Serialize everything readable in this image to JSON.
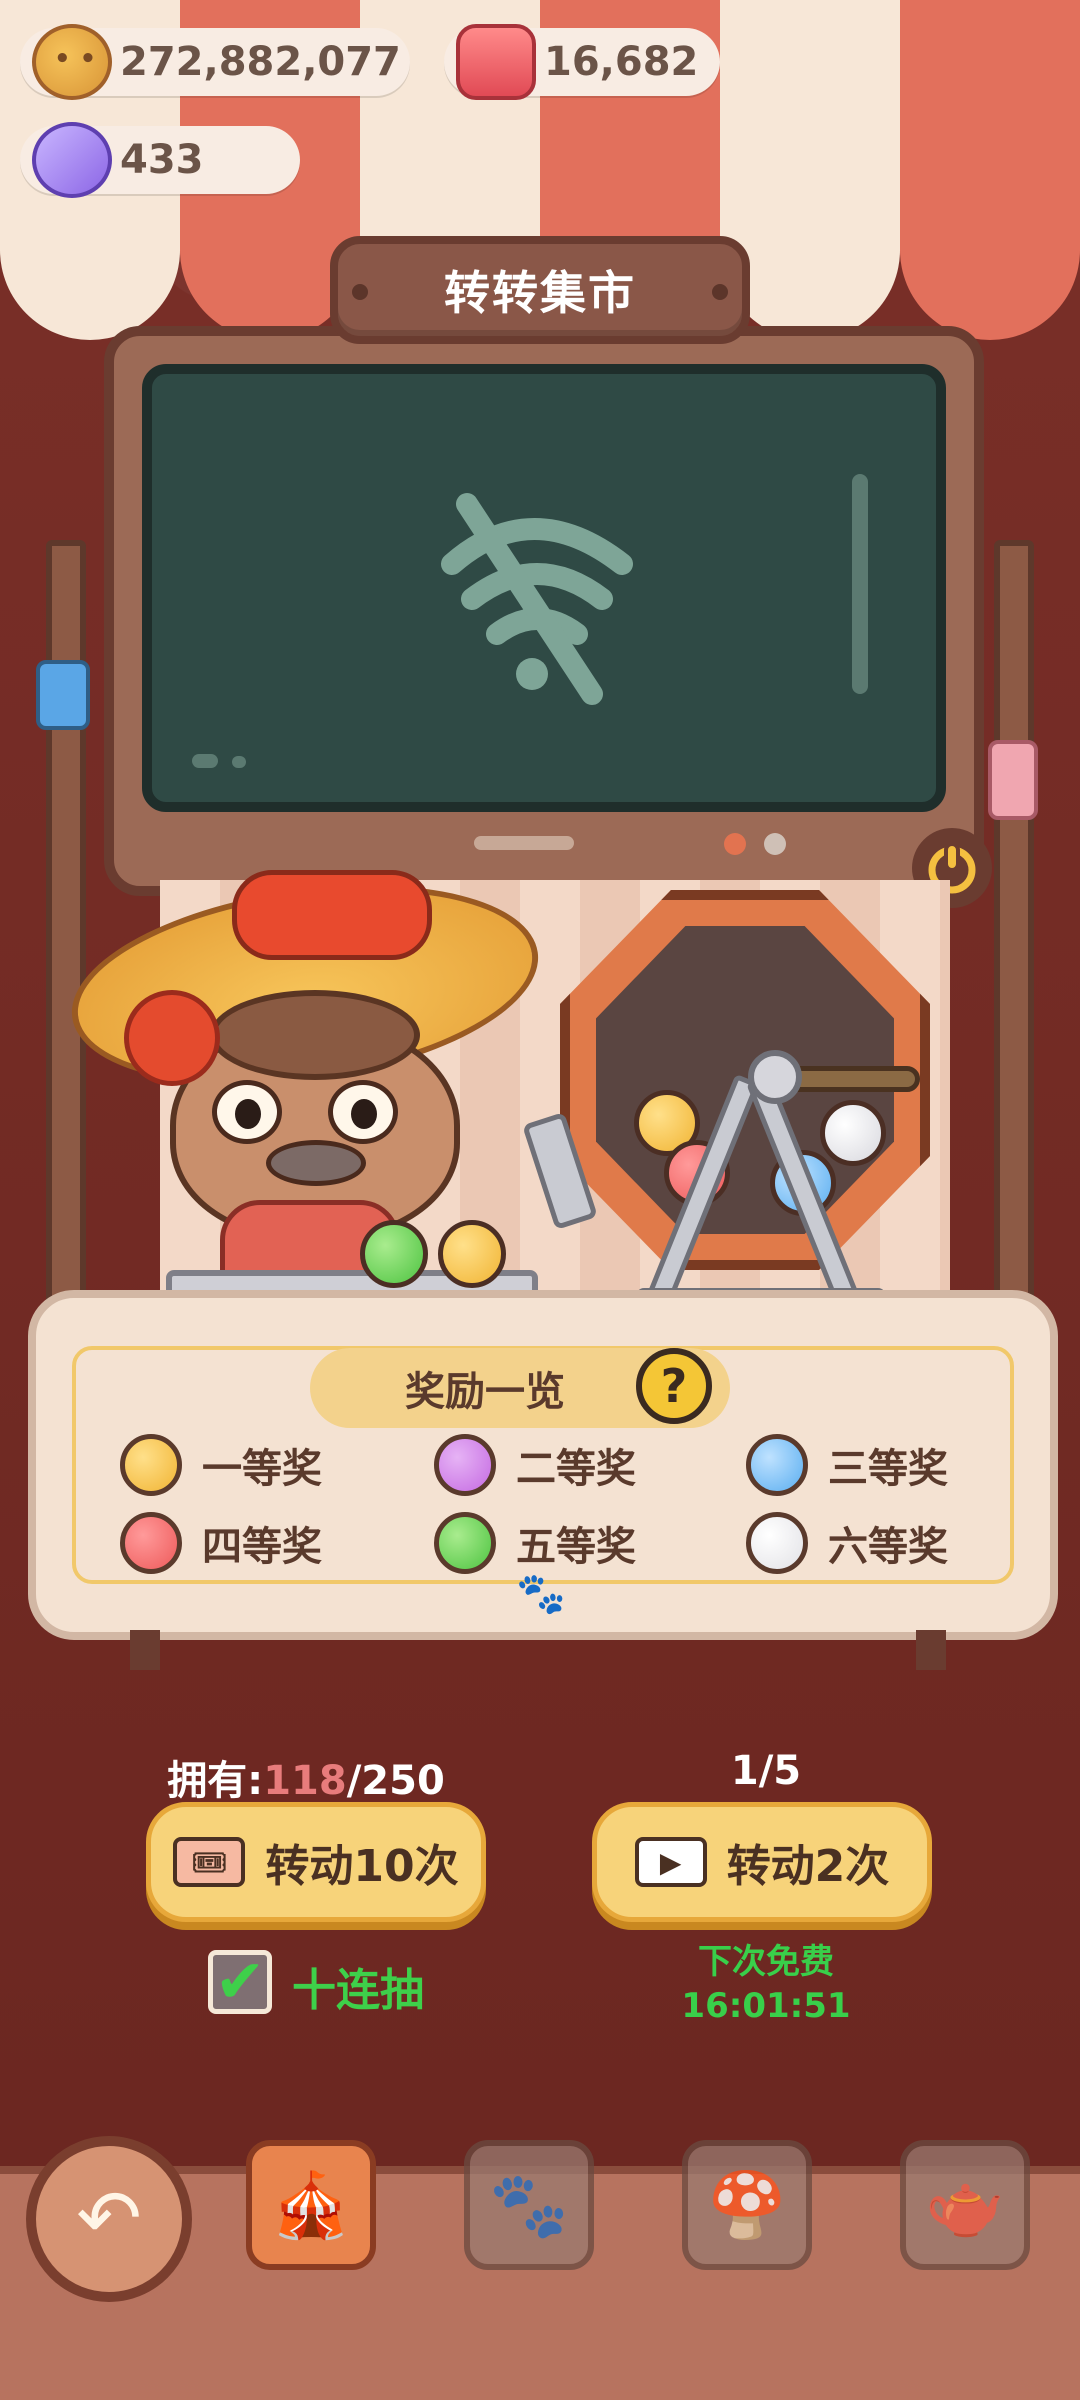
{
  "currencies": {
    "coins": "272,882,077",
    "candles": "16,682",
    "candy": "433"
  },
  "title": "转转集市",
  "rewards": {
    "title": "奖励一览",
    "help_icon": "?",
    "prizes": [
      {
        "label": "一等奖",
        "color": "#f1b433"
      },
      {
        "label": "二等奖",
        "color": "#c56ae2"
      },
      {
        "label": "三等奖",
        "color": "#5aaef0"
      },
      {
        "label": "四等奖",
        "color": "#ee5a5a"
      },
      {
        "label": "五等奖",
        "color": "#4ec441"
      },
      {
        "label": "六等奖",
        "color": "#f0f0f2"
      }
    ]
  },
  "spin": {
    "own_prefix": "拥有:",
    "own_count": "118",
    "own_total": "/250",
    "spin10_label": "转动10次",
    "free_count": "1/5",
    "spin2_label": "转动2次",
    "ten_pull_label": "十连抽",
    "ten_pull_checked": true,
    "next_free_label": "下次免费",
    "next_free_time": "16:01:51"
  },
  "icons": {
    "back": "back-icon",
    "wifi_off": "wifi-off-icon",
    "power": "power-icon"
  },
  "colors": {
    "accent": "#f7d37a",
    "green_text": "#39cf4a",
    "bg": "#6f2a24"
  }
}
